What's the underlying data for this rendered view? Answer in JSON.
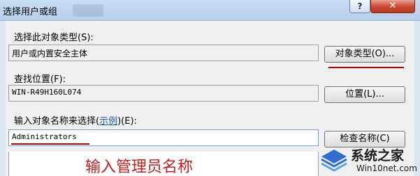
{
  "window": {
    "title": "选择用户或组",
    "help_label": "?",
    "close_label": "✕"
  },
  "object_type": {
    "label": "选择此对象类型(S):",
    "value": "用户或内置安全主体",
    "button": "对象类型(O)..."
  },
  "location": {
    "label": "查找位置(F):",
    "value": "WIN-R49H160L074",
    "button": "位置(L)..."
  },
  "names": {
    "label_prefix": "输入对象名称来选择(",
    "label_link": "示例",
    "label_suffix": ")(E):",
    "value": "Administrators",
    "check_button": "检查名称(C)"
  },
  "annotation": {
    "text": "输入管理员名称",
    "color": "#c41c1c"
  },
  "watermark": {
    "name": "系统之家",
    "url": "Win10net.com"
  }
}
